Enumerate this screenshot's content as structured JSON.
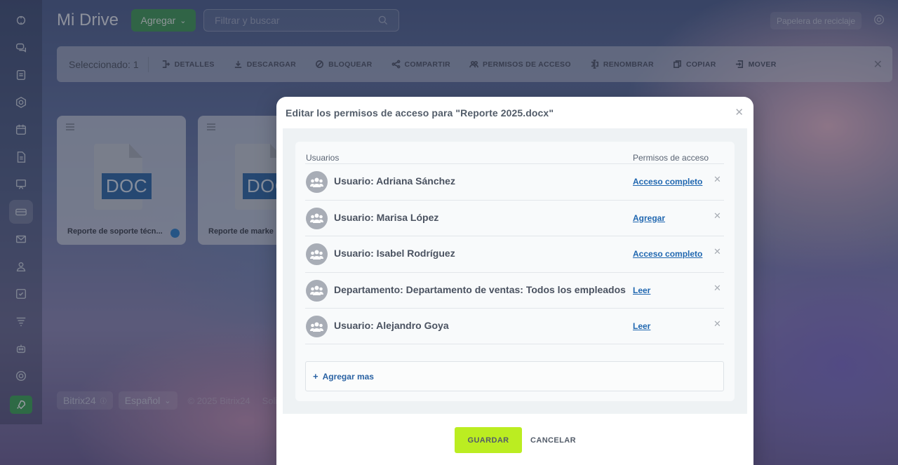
{
  "header": {
    "title": "Mi Drive",
    "add_label": "Agregar",
    "search_placeholder": "Filtrar y buscar",
    "trash_label": "Papelera de reciclaje"
  },
  "toolbar": {
    "selected_label": "Seleccionado: 1",
    "actions": [
      {
        "label": "DETALLES",
        "icon": "details-icon"
      },
      {
        "label": "DESCARGAR",
        "icon": "download-icon"
      },
      {
        "label": "BLOQUEAR",
        "icon": "block-icon"
      },
      {
        "label": "COMPARTIR",
        "icon": "share-icon"
      },
      {
        "label": "PERMISOS DE ACCESO",
        "icon": "permissions-icon"
      },
      {
        "label": "RENOMBRAR",
        "icon": "rename-icon"
      },
      {
        "label": "COPIAR",
        "icon": "copy-icon"
      },
      {
        "label": "MOVER",
        "icon": "move-icon"
      }
    ]
  },
  "files": [
    {
      "badge": "DOC",
      "name": "Reporte de soporte técn...",
      "shared": true
    },
    {
      "badge": "DOC",
      "name": "Reporte de marke",
      "shared": false
    }
  ],
  "footer": {
    "brand": "Bitrix24",
    "language": "Español",
    "copyright": "© 2025 Bitrix24",
    "extra": "Solic"
  },
  "modal": {
    "title": "Editar los permisos de acceso para \"Reporte 2025.docx\"",
    "col_users": "Usuarios",
    "col_permissions": "Permisos de acceso",
    "rows": [
      {
        "name": "Usuario: Adriana Sánchez",
        "permission": "Acceso completo"
      },
      {
        "name": "Usuario: Marisa López",
        "permission": "Agregar"
      },
      {
        "name": "Usuario: Isabel Rodríguez",
        "permission": "Acceso completo"
      },
      {
        "name": "Departamento: Departamento de ventas: Todos los empleados",
        "permission": "Leer"
      },
      {
        "name": "Usuario: Alejandro Goya",
        "permission": "Leer"
      }
    ],
    "add_more": "Agregar mas",
    "save_label": "GUARDAR",
    "cancel_label": "CANCELAR"
  },
  "colors": {
    "accent_green": "#3f9a57",
    "save_lime": "#bbed21",
    "link_blue": "#2067b0",
    "doc_blue": "#2c66a6"
  }
}
